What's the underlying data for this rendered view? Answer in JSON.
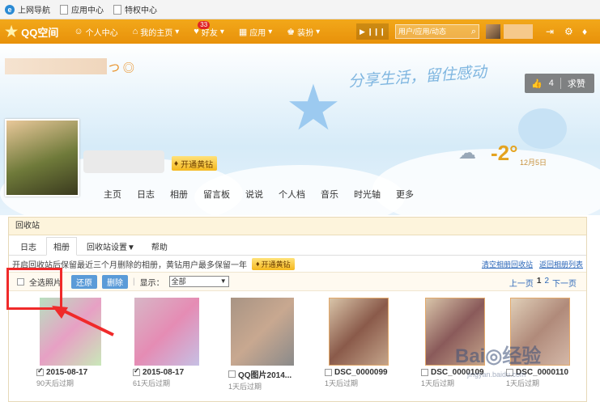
{
  "bookmarks": [
    {
      "icon": "ie-icon",
      "label": "上网导航"
    },
    {
      "icon": "page-icon",
      "label": "应用中心"
    },
    {
      "icon": "page-icon",
      "label": "特权中心"
    }
  ],
  "topnav": {
    "logo": "QQ空间",
    "items": [
      {
        "icon": "person-icon",
        "glyph": "☺",
        "label": "个人中心"
      },
      {
        "icon": "home-icon",
        "glyph": "⌂",
        "label": "我的主页"
      },
      {
        "icon": "friends-icon",
        "glyph": "♥",
        "label": "好友",
        "badge": "33"
      },
      {
        "icon": "apps-icon",
        "glyph": "▦",
        "label": "应用"
      },
      {
        "icon": "dress-icon",
        "glyph": "♚",
        "label": "装扮"
      }
    ],
    "search_placeholder": "用户/应用/动态"
  },
  "banner": {
    "slogan": "分享生活，留住感动",
    "like_count": "4",
    "like_label": "求赞",
    "vip_label": "开通黄钻",
    "weather_temp": "-2°",
    "weather_date": "12月5日",
    "tabs": [
      "主页",
      "日志",
      "相册",
      "留言板",
      "说说",
      "个人档",
      "音乐",
      "时光轴",
      "更多"
    ]
  },
  "recycle": {
    "title": "回收站",
    "tabs": [
      "日志",
      "相册",
      "回收站设置▼",
      "帮助"
    ],
    "notice": "开启回收站后保留最近三个月删除的相册，黄钻用户最多保留一年",
    "vip_label": "开通黄钻",
    "links": [
      "清空相册回收站",
      "返回相册列表"
    ],
    "select_all": "全选照片",
    "restore": "还原",
    "delete": "删除",
    "show_label": "显示：",
    "filter": "全部",
    "pager": {
      "prev": "上一页",
      "current": "1",
      "next_page": "2",
      "next": "下一页"
    },
    "photos": [
      {
        "name": "2015-08-17",
        "expire": "90天后过期",
        "checked": true
      },
      {
        "name": "2015-08-17",
        "expire": "61天后过期",
        "checked": true
      },
      {
        "name": "QQ图片2014...",
        "expire": "1天后过期",
        "checked": false
      },
      {
        "name": "DSC_0000099",
        "expire": "1天后过期",
        "checked": false
      },
      {
        "name": "DSC_0000109",
        "expire": "1天后过期",
        "checked": false
      },
      {
        "name": "DSC_0000110",
        "expire": "1天后过期",
        "checked": false
      }
    ]
  },
  "watermark": {
    "main": "Bai◎经验",
    "sub": "jingyan.baidu.com"
  }
}
